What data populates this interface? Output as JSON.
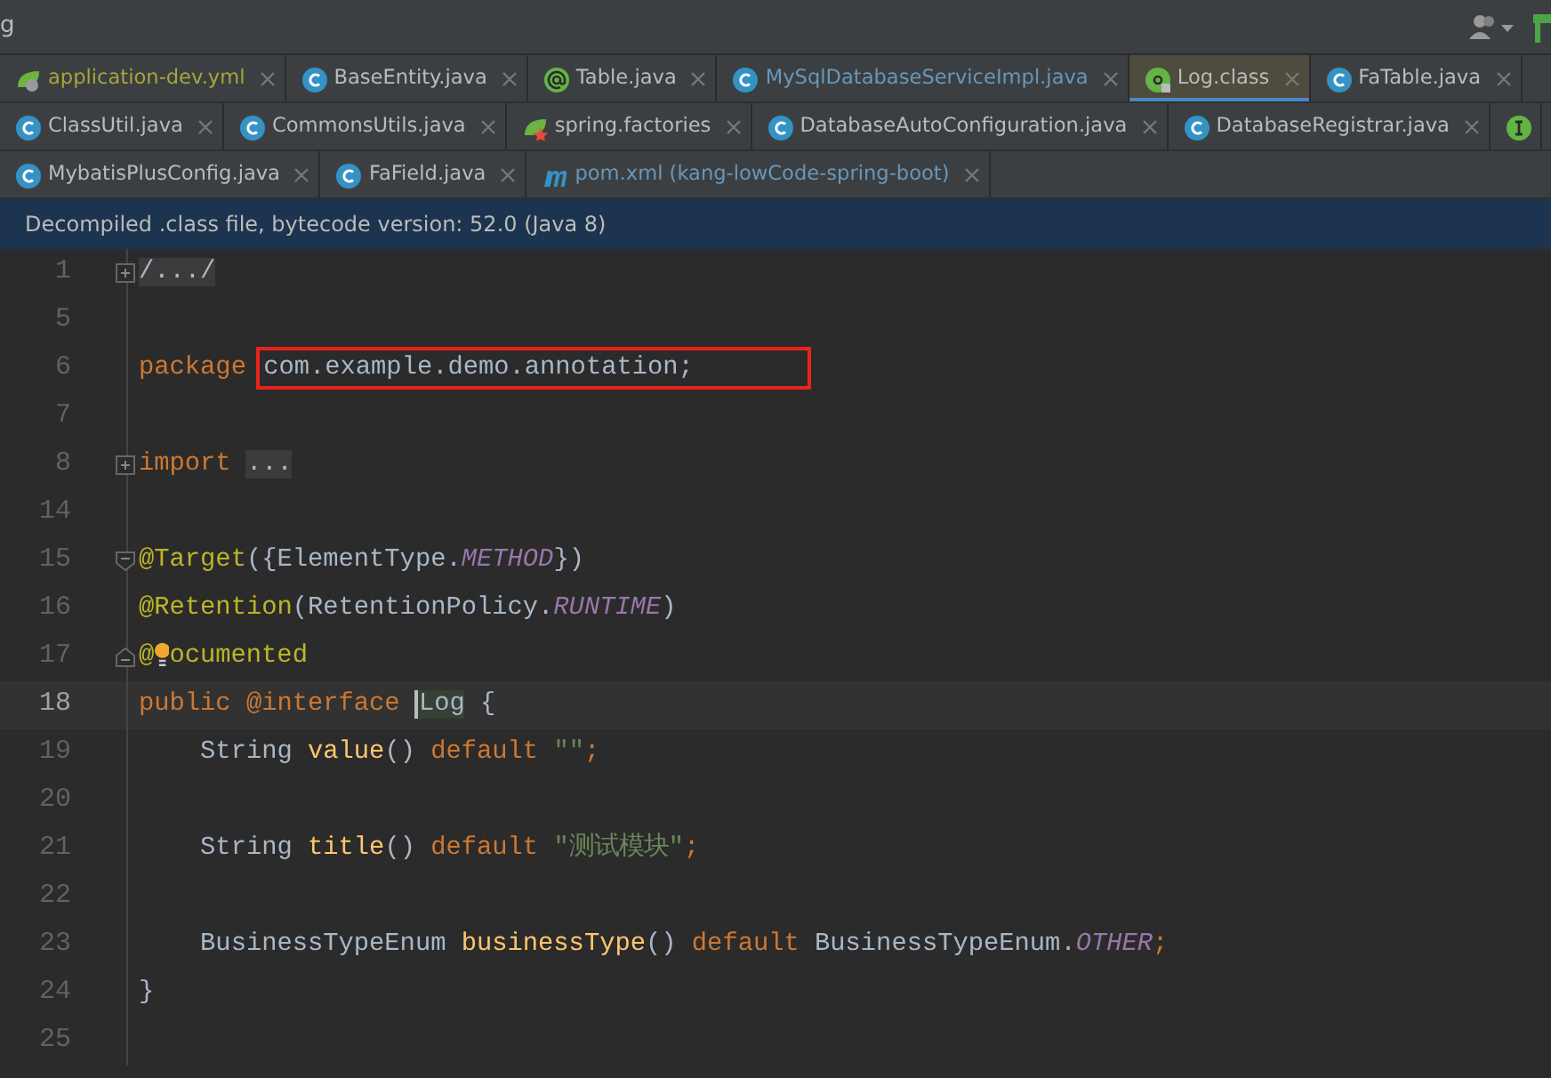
{
  "title_fragment": "g",
  "tab_rows": [
    [
      {
        "label": "application-dev.yml",
        "kind": "spring-config",
        "color": "#a4a63a",
        "selected": false
      },
      {
        "label": "BaseEntity.java",
        "kind": "class",
        "selected": false
      },
      {
        "label": "Table.java",
        "kind": "annotation",
        "selected": false
      },
      {
        "label": "MySqlDatabaseServiceImpl.java",
        "kind": "class",
        "color": "#6897bb",
        "selected": false
      },
      {
        "label": "Log.class",
        "kind": "annotation-locked",
        "selected": true
      },
      {
        "label": "FaTable.java",
        "kind": "class",
        "selected": false
      }
    ],
    [
      {
        "label": "ClassUtil.java",
        "kind": "class",
        "selected": false
      },
      {
        "label": "CommonsUtils.java",
        "kind": "class",
        "selected": false
      },
      {
        "label": "spring.factories",
        "kind": "spring-factories",
        "selected": false
      },
      {
        "label": "DatabaseAutoConfiguration.java",
        "kind": "class",
        "selected": false
      },
      {
        "label": "DatabaseRegistrar.java",
        "kind": "class",
        "selected": false
      },
      {
        "kind": "interface",
        "selected": false
      }
    ],
    [
      {
        "label": "MybatisPlusConfig.java",
        "kind": "class",
        "selected": false
      },
      {
        "label": "FaField.java",
        "kind": "class",
        "selected": false
      },
      {
        "label": "pom.xml (kang-lowCode-spring-boot)",
        "kind": "maven",
        "color": "#6897bb",
        "selected": false
      }
    ]
  ],
  "banner": "Decompiled .class file, bytecode version: 52.0 (Java 8)",
  "lines": [
    {
      "number": "1",
      "gutter": {
        "kind": "collapsed"
      },
      "tokens": [
        {
          "kind": "folded",
          "text": "/.../"
        }
      ]
    },
    {
      "number": "5"
    },
    {
      "number": "6",
      "tokens": [
        {
          "kind": "keyword",
          "text": "package "
        },
        {
          "kind": "plain",
          "text": "com.example.demo.annotation;",
          "boxed": true
        }
      ]
    },
    {
      "number": "7"
    },
    {
      "number": "8",
      "gutter": {
        "kind": "collapsed"
      },
      "tokens": [
        {
          "kind": "keyword",
          "text": "import "
        },
        {
          "kind": "folded",
          "text": "..."
        }
      ]
    },
    {
      "number": "14"
    },
    {
      "number": "15",
      "gutter": {
        "kind": "start"
      },
      "tokens": [
        {
          "kind": "annotation",
          "text": "@Target"
        },
        {
          "kind": "plain",
          "text": "({ElementType."
        },
        {
          "kind": "constant",
          "text": "METHOD"
        },
        {
          "kind": "plain",
          "text": "})"
        }
      ]
    },
    {
      "number": "16",
      "tokens": [
        {
          "kind": "annotation",
          "text": "@Retention"
        },
        {
          "kind": "plain",
          "text": "(RetentionPolicy."
        },
        {
          "kind": "constant",
          "text": "RUNTIME"
        },
        {
          "kind": "plain",
          "text": ")"
        }
      ]
    },
    {
      "number": "17",
      "gutter": {
        "kind": "end"
      },
      "tokens": [
        {
          "kind": "annotation",
          "text": "@"
        },
        {
          "kind": "annotation",
          "text": "ocumented",
          "bulb_before": true
        }
      ]
    },
    {
      "number": "18",
      "current": true,
      "tokens": [
        {
          "kind": "keyword",
          "text": "public @interface "
        },
        {
          "kind": "plain",
          "text": "Log",
          "highlighted": true,
          "caret_before": true
        },
        {
          "kind": "plain",
          "text": " {"
        }
      ]
    },
    {
      "number": "19",
      "tokens": [
        {
          "kind": "plain",
          "text": "    String "
        },
        {
          "kind": "method",
          "text": "value"
        },
        {
          "kind": "plain",
          "text": "() "
        },
        {
          "kind": "keyword",
          "text": "default "
        },
        {
          "kind": "string",
          "text": "\"\""
        },
        {
          "kind": "keyword",
          "text": ";"
        }
      ]
    },
    {
      "number": "20"
    },
    {
      "number": "21",
      "tokens": [
        {
          "kind": "plain",
          "text": "    String "
        },
        {
          "kind": "method",
          "text": "title"
        },
        {
          "kind": "plain",
          "text": "() "
        },
        {
          "kind": "keyword",
          "text": "default "
        },
        {
          "kind": "string",
          "text": "\"测试模块\""
        },
        {
          "kind": "keyword",
          "text": ";"
        }
      ]
    },
    {
      "number": "22"
    },
    {
      "number": "23",
      "tokens": [
        {
          "kind": "plain",
          "text": "    BusinessTypeEnum "
        },
        {
          "kind": "method",
          "text": "businessType"
        },
        {
          "kind": "plain",
          "text": "() "
        },
        {
          "kind": "keyword",
          "text": "default "
        },
        {
          "kind": "plain",
          "text": "BusinessTypeEnum."
        },
        {
          "kind": "constant",
          "text": "OTHER"
        },
        {
          "kind": "keyword",
          "text": ";"
        }
      ]
    },
    {
      "number": "24",
      "tokens": [
        {
          "kind": "plain",
          "text": "}"
        }
      ]
    },
    {
      "number": "25"
    }
  ]
}
